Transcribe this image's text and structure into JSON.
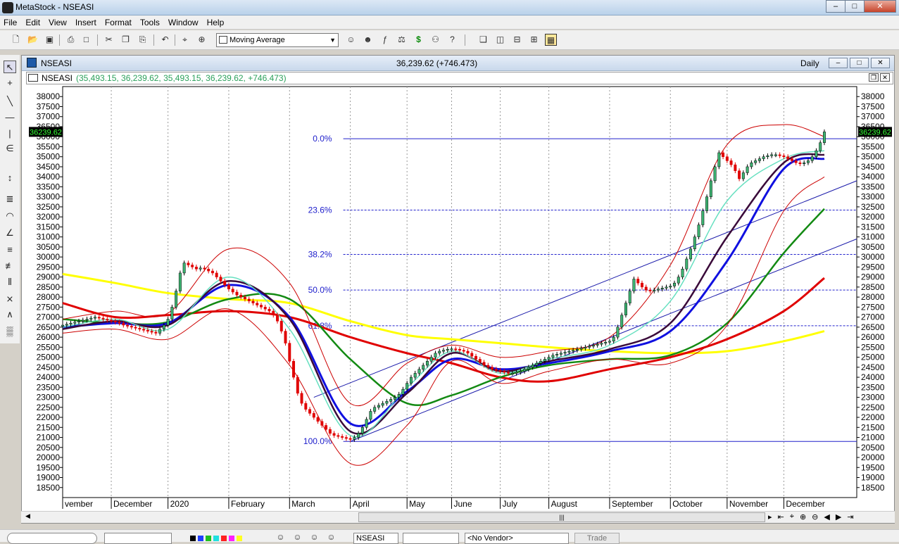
{
  "window": {
    "title": "MetaStock - NSEASI",
    "min": "–",
    "max": "□",
    "close": "✕"
  },
  "menu": [
    "File",
    "Edit",
    "View",
    "Insert",
    "Format",
    "Tools",
    "Window",
    "Help"
  ],
  "toolbar": {
    "indicator_select": "Moving Average"
  },
  "chart_window": {
    "name": "NSEASI",
    "price": "36,239.62 (+746.473)",
    "period": "Daily",
    "btn_min": "–",
    "btn_restore": "□",
    "btn_close": "✕"
  },
  "inner_title": {
    "symbol": "NSEASI",
    "ohlc": "(35,493.15, 36,239.62, 35,493.15, 36,239.62, +746.473)",
    "btn_restore": "❐",
    "btn_close": "✕"
  },
  "status": {
    "symbol_field": "NSEASI",
    "vendor_field": "<No Vendor>",
    "trade_button": "Trade"
  },
  "colors": {
    "up": "#3cb371",
    "down": "#e00000",
    "ma_yellow": "#ffff00",
    "ma_red": "#e00000",
    "ma_green": "#138a13",
    "ma_blue": "#1010e0",
    "ma_purple": "#3a0a3a",
    "ma_cyan": "#66e0c0",
    "band": "#cc0000",
    "fib": "#2020cc",
    "last_label_bg": "#000000",
    "last_label_fg": "#33ff33"
  },
  "chart_data": {
    "type": "line",
    "subtype": "candlestick",
    "ylim": [
      18000,
      38500
    ],
    "yticks": [
      18500,
      19000,
      19500,
      20000,
      20500,
      21000,
      21500,
      22000,
      22500,
      23000,
      23500,
      24000,
      24500,
      25000,
      25500,
      26000,
      26500,
      27000,
      27500,
      28000,
      28500,
      29000,
      29500,
      30000,
      30500,
      31000,
      31500,
      32000,
      32500,
      33000,
      33500,
      34000,
      34500,
      35000,
      35500,
      36000,
      36500,
      37000,
      37500,
      38000
    ],
    "last_value": "36239.62",
    "x_month_labels": [
      "vember",
      "December",
      "2020",
      "February",
      "March",
      "April",
      "May",
      "June",
      "July",
      "August",
      "September",
      "October",
      "November",
      "December"
    ],
    "x_month_ticks": [
      0,
      12,
      26,
      41,
      56,
      71,
      85,
      96,
      108,
      120,
      135,
      150,
      164,
      178
    ],
    "x_range": [
      0,
      196
    ],
    "close": [
      26600,
      26650,
      26700,
      26750,
      26800,
      26850,
      26900,
      26950,
      27000,
      26950,
      26900,
      26850,
      26800,
      26750,
      26700,
      26600,
      26550,
      26500,
      26450,
      26400,
      26350,
      26300,
      26250,
      26200,
      26400,
      26600,
      26900,
      27500,
      28300,
      29200,
      29700,
      29600,
      29500,
      29400,
      29450,
      29400,
      29300,
      29200,
      29000,
      28800,
      28600,
      28400,
      28250,
      28100,
      28000,
      27900,
      27800,
      27700,
      27600,
      27500,
      27400,
      27300,
      27100,
      26800,
      26300,
      25700,
      24800,
      24000,
      23200,
      22700,
      22400,
      22200,
      22000,
      21800,
      21600,
      21400,
      21200,
      21100,
      21050,
      21000,
      20950,
      20900,
      21000,
      21200,
      21500,
      21900,
      22300,
      22500,
      22600,
      22700,
      22800,
      22900,
      23000,
      23150,
      23400,
      23700,
      24000,
      24200,
      24400,
      24600,
      24800,
      25000,
      25200,
      25300,
      25350,
      25400,
      25420,
      25400,
      25350,
      25300,
      25200,
      25050,
      24900,
      24750,
      24600,
      24500,
      24400,
      24350,
      24300,
      24250,
      24200,
      24200,
      24250,
      24300,
      24400,
      24500,
      24600,
      24700,
      24800,
      24900,
      25000,
      25100,
      25150,
      25200,
      25250,
      25300,
      25350,
      25400,
      25450,
      25500,
      25550,
      25600,
      25650,
      25700,
      25750,
      25800,
      26000,
      26500,
      27100,
      27700,
      28300,
      28900,
      28700,
      28500,
      28350,
      28300,
      28350,
      28400,
      28450,
      28500,
      28550,
      28700,
      29000,
      29400,
      29900,
      30400,
      31000,
      31600,
      32300,
      33000,
      33800,
      34500,
      35200,
      35000,
      34800,
      34600,
      34300,
      33900,
      34200,
      34500,
      34700,
      34800,
      34900,
      35000,
      35050,
      35100,
      35100,
      35050,
      35000,
      34900,
      34800,
      34700,
      34650,
      34700,
      34800,
      35000,
      35300,
      35700,
      36239.62
    ],
    "ma_yellow": [
      29200,
      29100,
      29000,
      28900,
      28800,
      28700,
      28600,
      28500,
      28400,
      28300,
      28200,
      28150,
      28100,
      28050,
      28000,
      27950,
      27900,
      27850,
      27800,
      27750,
      27700,
      27650,
      27600,
      27550,
      27400,
      27250,
      27100,
      26950,
      26800,
      26650,
      26500,
      26350,
      26200,
      26100,
      26000,
      25950,
      25900,
      25850,
      25800,
      25700,
      25600,
      25500,
      25400,
      25300,
      25200,
      25150,
      25100,
      25200,
      25350,
      25500,
      25650,
      25800,
      25950,
      26100,
      26300,
      26500,
      26700,
      26900,
      27100,
      27300
    ],
    "ma_yellow_x": [
      0,
      4,
      8,
      12,
      16,
      20,
      24,
      28,
      32,
      36,
      40,
      44,
      48,
      52,
      56,
      60,
      64,
      68,
      72,
      76,
      80,
      84,
      88,
      92,
      96,
      100,
      104,
      108,
      112,
      116,
      120,
      124,
      128,
      132,
      136,
      140,
      144,
      148,
      152,
      156,
      160,
      164,
      168,
      172,
      176,
      178,
      180,
      182,
      184,
      186,
      188,
      190,
      192,
      194,
      196,
      197,
      198,
      199,
      200,
      201
    ],
    "series": [
      {
        "name": "",
        "color": "#ffff00",
        "x": [
          0,
          13,
          26,
          41,
          56,
          71,
          85,
          96,
          108,
          120,
          135,
          150,
          164,
          178,
          188
        ],
        "values": [
          29150,
          28700,
          28200,
          27900,
          27700,
          26800,
          26100,
          25900,
          25700,
          25500,
          25300,
          25200,
          25300,
          25800,
          26300
        ]
      },
      {
        "name": "",
        "color": "#e00000",
        "x": [
          0,
          13,
          26,
          41,
          56,
          71,
          85,
          96,
          108,
          120,
          135,
          150,
          164,
          178,
          188
        ],
        "values": [
          27700,
          27000,
          27100,
          27300,
          27000,
          26000,
          25200,
          24700,
          24000,
          23800,
          24400,
          25000,
          25900,
          27300,
          28950
        ]
      },
      {
        "name": "",
        "color": "#138a13",
        "x": [
          0,
          13,
          26,
          41,
          56,
          71,
          85,
          96,
          108,
          120,
          135,
          150,
          164,
          178,
          188
        ],
        "values": [
          26900,
          26700,
          26750,
          27900,
          27900,
          24900,
          22700,
          23100,
          24000,
          24600,
          24900,
          25100,
          26700,
          30200,
          32400
        ]
      },
      {
        "name": "",
        "color": "#1010e0",
        "x": [
          0,
          13,
          26,
          41,
          56,
          71,
          85,
          96,
          108,
          120,
          135,
          150,
          164,
          178,
          188
        ],
        "values": [
          26500,
          26700,
          26700,
          28600,
          27000,
          21700,
          23300,
          24900,
          24400,
          24700,
          25300,
          26300,
          29800,
          34400,
          34900
        ]
      },
      {
        "name": "",
        "color": "#3a0a3a",
        "x": [
          0,
          13,
          26,
          41,
          56,
          71,
          85,
          96,
          108,
          120,
          135,
          150,
          164,
          178,
          188
        ],
        "values": [
          26400,
          26800,
          26600,
          28800,
          26900,
          21300,
          23200,
          25200,
          24300,
          24800,
          25400,
          26700,
          31000,
          34700,
          35100
        ]
      },
      {
        "name": "",
        "color": "#66e0c0",
        "x": [
          0,
          13,
          26,
          41,
          56,
          71,
          85,
          96,
          108,
          120,
          135,
          150,
          164,
          178,
          188
        ],
        "values": [
          26500,
          26900,
          26400,
          29000,
          26400,
          21100,
          23500,
          25300,
          24200,
          24900,
          25600,
          27800,
          32800,
          34900,
          35300
        ]
      },
      {
        "name": "",
        "color": "#cc0000",
        "x": [
          0,
          13,
          26,
          41,
          56,
          71,
          85,
          96,
          108,
          120,
          135,
          150,
          164,
          178,
          188
        ],
        "values": [
          26900,
          27300,
          27200,
          30400,
          28700,
          22700,
          24700,
          25600,
          25000,
          25300,
          26000,
          29600,
          35600,
          36600,
          36000
        ]
      },
      {
        "name": "",
        "color": "#cc0000",
        "x": [
          0,
          13,
          26,
          41,
          56,
          71,
          85,
          96,
          108,
          120,
          135,
          150,
          164,
          178,
          188
        ],
        "values": [
          26200,
          26400,
          25900,
          27400,
          24600,
          19700,
          21600,
          24800,
          23700,
          24300,
          24900,
          24700,
          26600,
          32300,
          34000
        ]
      }
    ],
    "fibonacci": {
      "high": 35900,
      "low": 20800,
      "x_start": 71,
      "x_end": 196,
      "levels": [
        {
          "label": "0.0%",
          "value": 35900
        },
        {
          "label": "23.6%",
          "value": 32340
        },
        {
          "label": "38.2%",
          "value": 30130
        },
        {
          "label": "50.0%",
          "value": 28350
        },
        {
          "label": "61.8%",
          "value": 26570
        },
        {
          "label": "100.0%",
          "value": 20800
        }
      ]
    },
    "trendlines": [
      {
        "x1": 62,
        "y1": 23000,
        "x2": 196,
        "y2": 33800
      },
      {
        "x1": 71,
        "y1": 20800,
        "x2": 196,
        "y2": 30900
      }
    ],
    "grid": "vertical-dotted",
    "legend": "none"
  }
}
